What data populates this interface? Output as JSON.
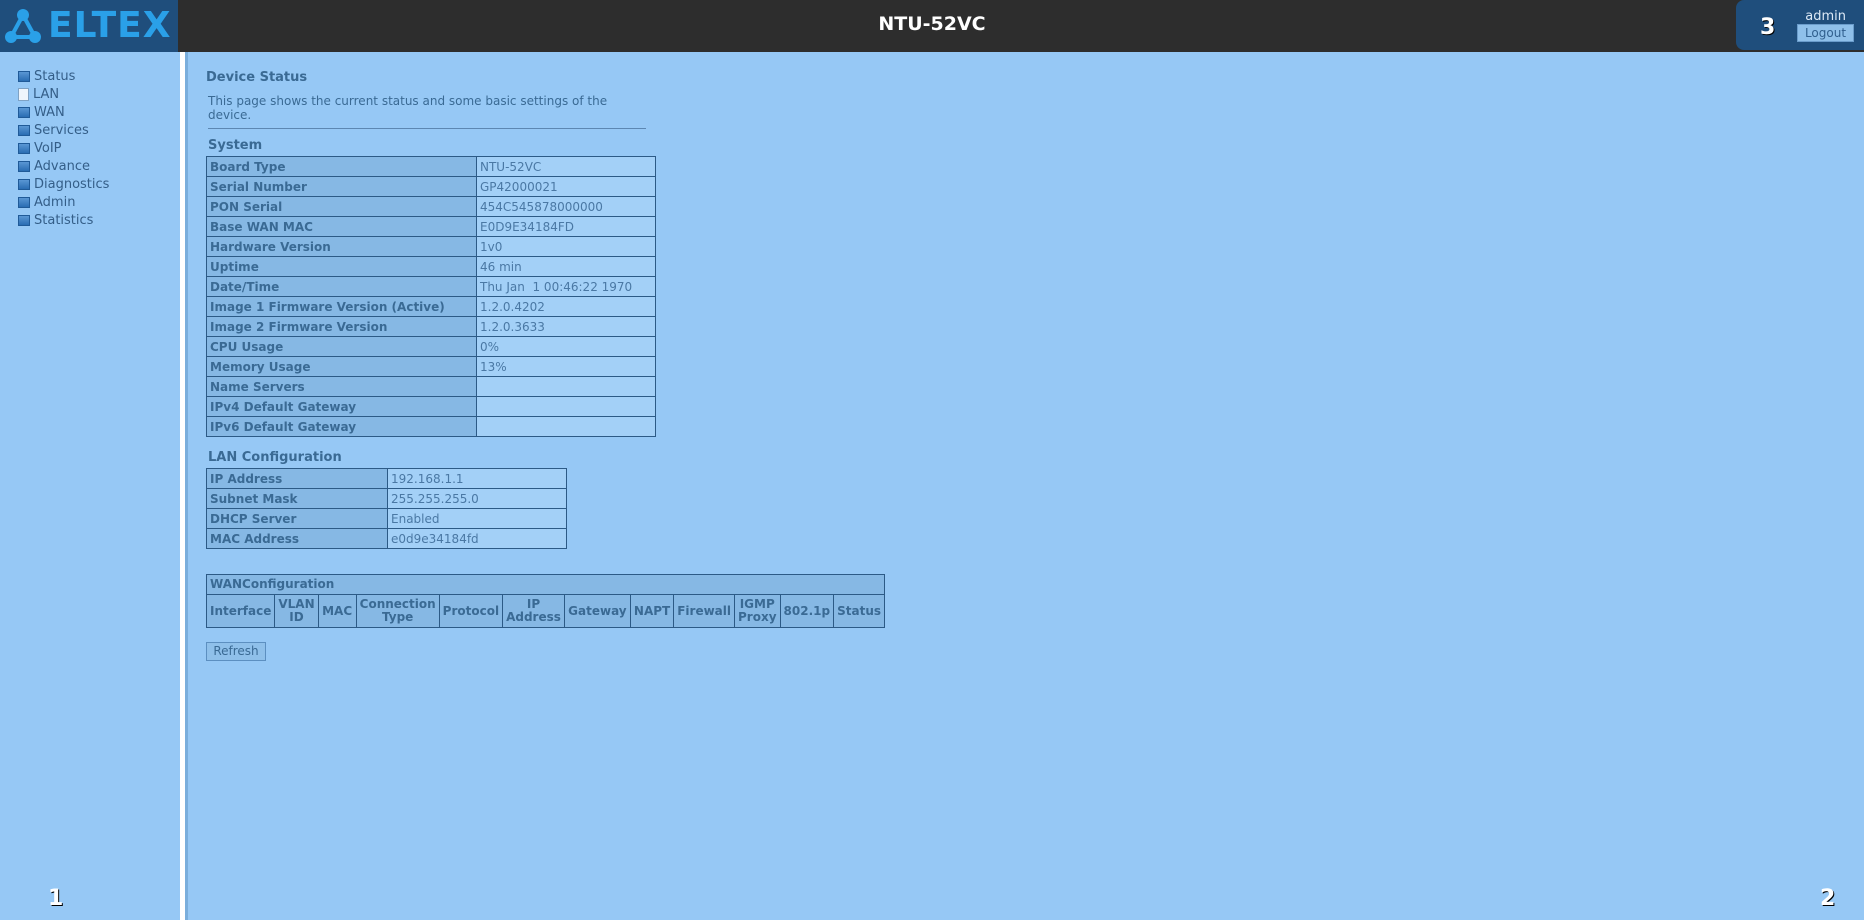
{
  "header": {
    "logo_text": "ELTEX",
    "device_name": "NTU-52VC",
    "user_box_number": "3",
    "username": "admin",
    "logout_label": "Logout"
  },
  "sidebar": {
    "items": [
      {
        "label": "Status",
        "icon": "folder-icon"
      },
      {
        "label": "LAN",
        "icon": "document-icon"
      },
      {
        "label": "WAN",
        "icon": "folder-icon"
      },
      {
        "label": "Services",
        "icon": "folder-icon"
      },
      {
        "label": "VoIP",
        "icon": "folder-icon"
      },
      {
        "label": "Advance",
        "icon": "folder-icon"
      },
      {
        "label": "Diagnostics",
        "icon": "folder-icon"
      },
      {
        "label": "Admin",
        "icon": "folder-icon"
      },
      {
        "label": "Statistics",
        "icon": "folder-icon"
      }
    ],
    "corner_number": "1"
  },
  "main": {
    "heading": "Device Status",
    "description": "This page shows the current status and some basic settings of the device.",
    "corner_number": "2",
    "system": {
      "title": "System",
      "rows": [
        {
          "key": "Board Type",
          "value": "NTU-52VC"
        },
        {
          "key": "Serial Number",
          "value": "GP42000021"
        },
        {
          "key": "PON Serial",
          "value": "454C545878000000"
        },
        {
          "key": "Base WAN MAC",
          "value": "E0D9E34184FD"
        },
        {
          "key": "Hardware Version",
          "value": "1v0"
        },
        {
          "key": "Uptime",
          "value": "46 min"
        },
        {
          "key": "Date/Time",
          "value": "Thu Jan  1 00:46:22 1970"
        },
        {
          "key": "Image 1 Firmware Version (Active)",
          "value": "1.2.0.4202"
        },
        {
          "key": "Image 2 Firmware Version",
          "value": "1.2.0.3633"
        },
        {
          "key": "CPU Usage",
          "value": "0%"
        },
        {
          "key": "Memory Usage",
          "value": "13%"
        },
        {
          "key": "Name Servers",
          "value": ""
        },
        {
          "key": "IPv4 Default Gateway",
          "value": ""
        },
        {
          "key": "IPv6 Default Gateway",
          "value": ""
        }
      ]
    },
    "lan": {
      "title": "LAN Configuration",
      "rows": [
        {
          "key": "IP Address",
          "value": "192.168.1.1"
        },
        {
          "key": "Subnet Mask",
          "value": "255.255.255.0"
        },
        {
          "key": "DHCP Server",
          "value": "Enabled"
        },
        {
          "key": "MAC Address",
          "value": "e0d9e34184fd"
        }
      ]
    },
    "wan": {
      "title": "WANConfiguration",
      "columns": [
        "Interface",
        "VLAN ID",
        "MAC",
        "Connection Type",
        "Protocol",
        "IP Address",
        "Gateway",
        "NAPT",
        "Firewall",
        "IGMP Proxy",
        "802.1p",
        "Status"
      ]
    },
    "refresh_label": "Refresh"
  }
}
